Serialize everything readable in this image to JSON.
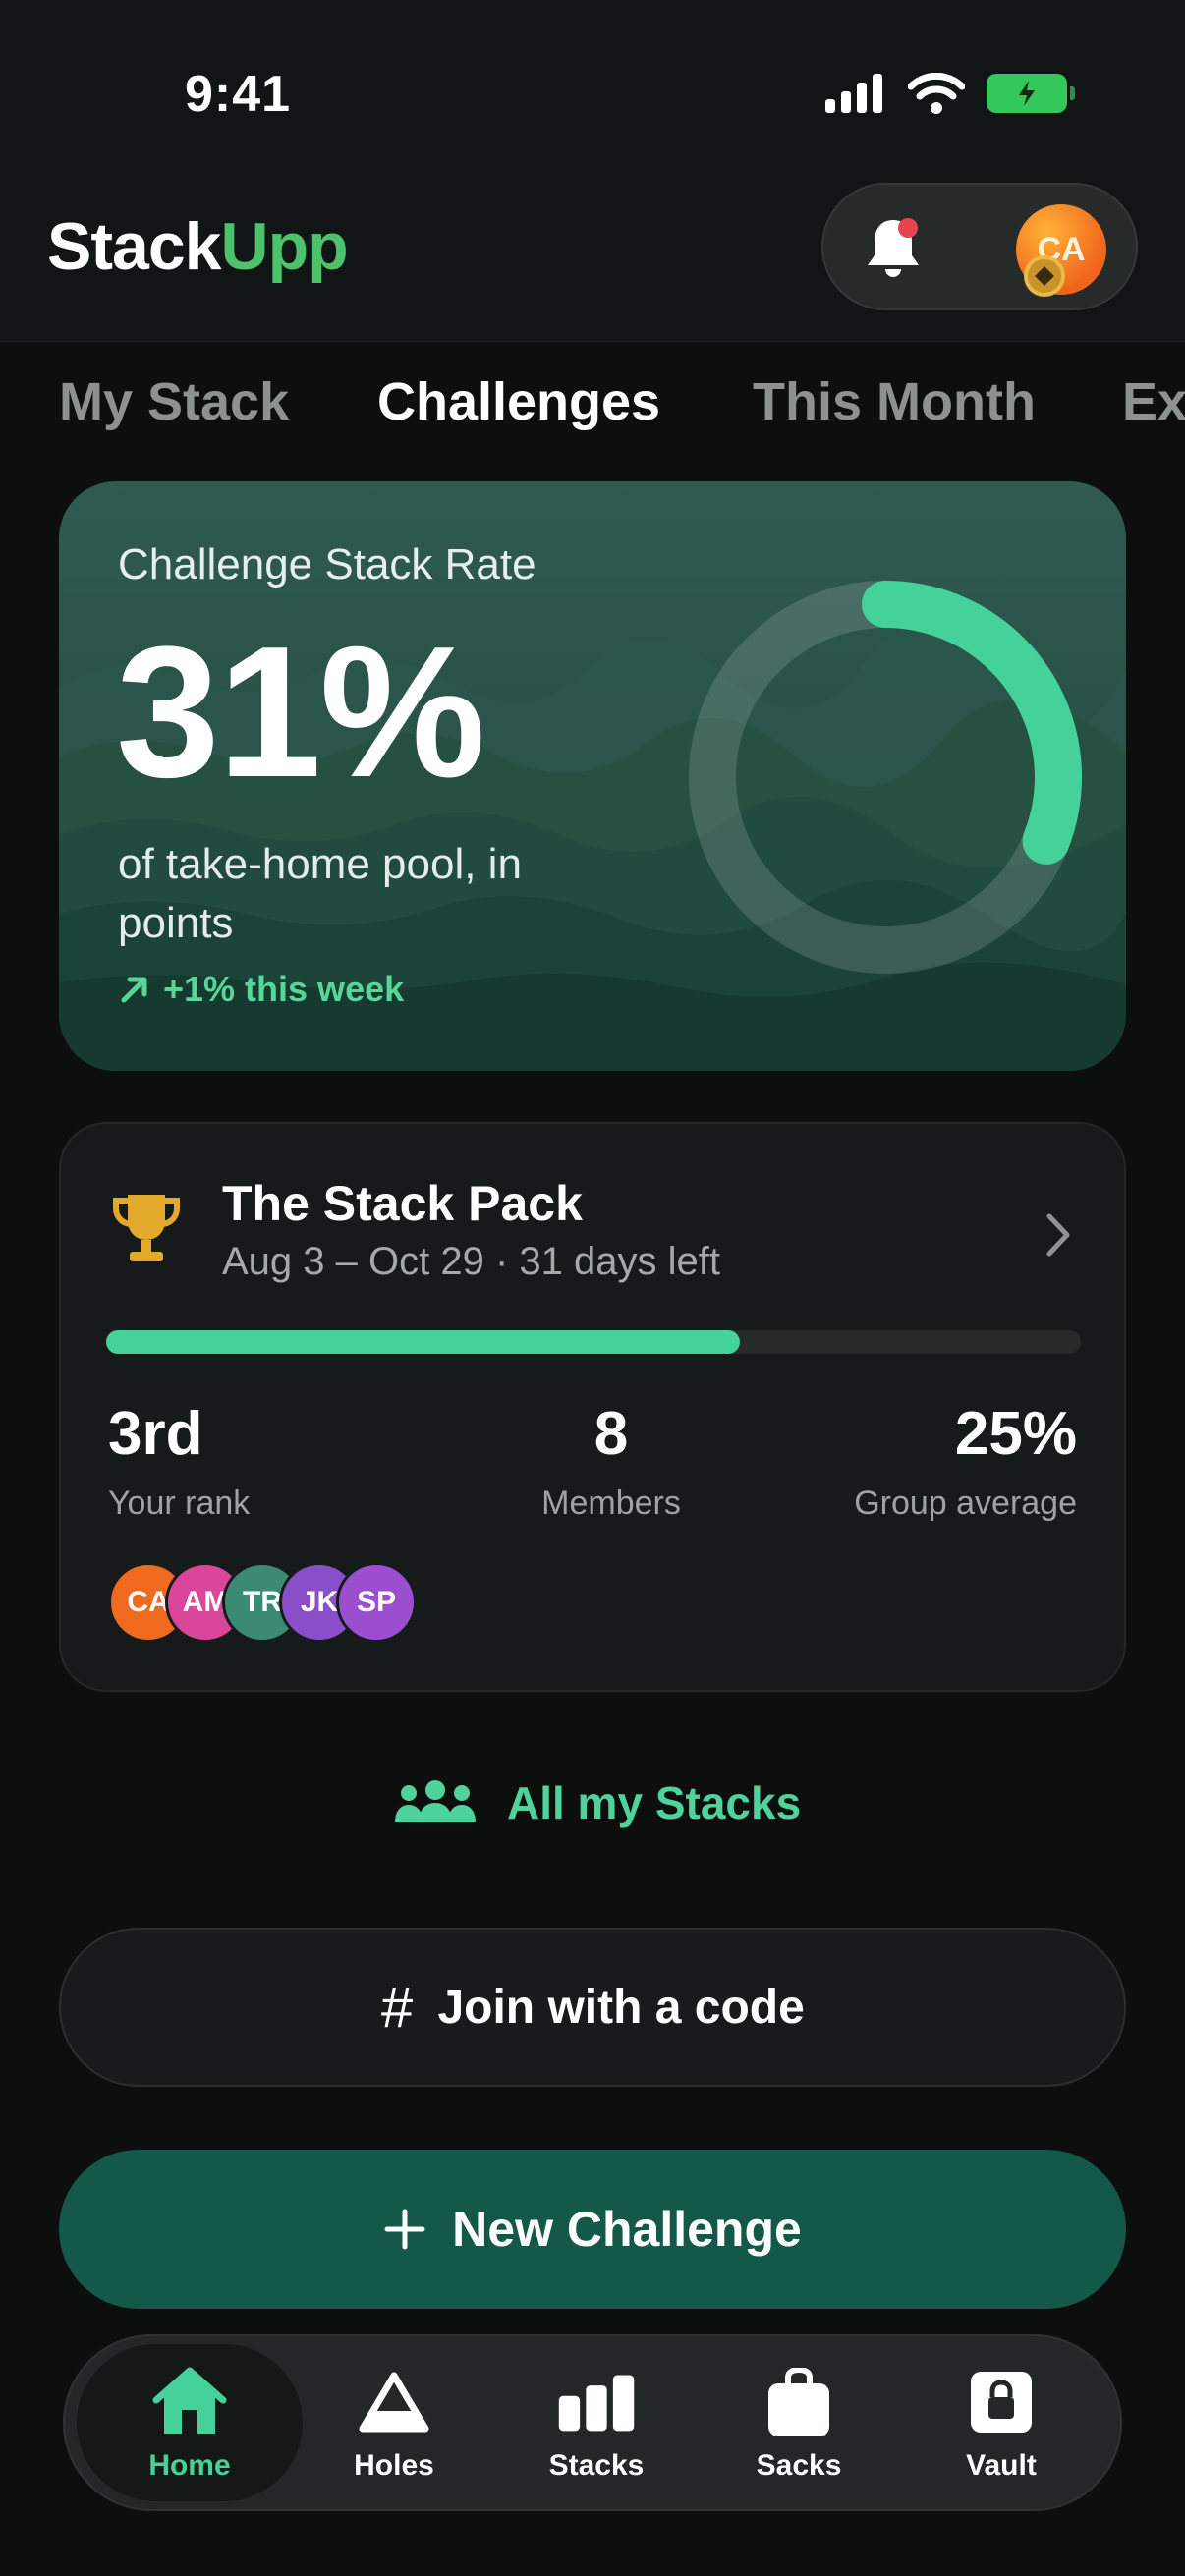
{
  "status_bar": {
    "time": "9:41"
  },
  "header": {
    "logo_part1": "Stack",
    "logo_part2": "Upp",
    "avatar_initials": "CA"
  },
  "tabs": [
    {
      "label": "My Stack",
      "active": false
    },
    {
      "label": "Challenges",
      "active": true
    },
    {
      "label": "This Month",
      "active": false
    },
    {
      "label": "Ex",
      "active": false
    }
  ],
  "hero": {
    "title": "Challenge Stack Rate",
    "value": "31%",
    "description": "of take-home pool, in points",
    "trend": "+1% this week",
    "ring_fraction": 0.31,
    "accent_color": "#45d29a"
  },
  "pack": {
    "title": "The Stack Pack",
    "subtitle": "Aug 3 – Oct 29 · 31 days left",
    "progress_fraction": 0.65,
    "stats": [
      {
        "value": "3rd",
        "label": "Your rank"
      },
      {
        "value": "8",
        "label": "Members"
      },
      {
        "value": "25%",
        "label": "Group average"
      }
    ],
    "members": [
      {
        "initials": "CA",
        "color": "#ef6a1f"
      },
      {
        "initials": "AM",
        "color": "#d9469a"
      },
      {
        "initials": "TR",
        "color": "#3a8a74"
      },
      {
        "initials": "JK",
        "color": "#8a4fc8"
      },
      {
        "initials": "SP",
        "color": "#9b4fcf"
      }
    ]
  },
  "links": {
    "all_stacks": "All my Stacks"
  },
  "buttons": {
    "join": "Join with a code",
    "new_challenge": "New Challenge"
  },
  "nav": [
    {
      "label": "Home",
      "icon": "home-icon",
      "active": true
    },
    {
      "label": "Holes",
      "icon": "flag-triangle-icon",
      "active": false
    },
    {
      "label": "Stacks",
      "icon": "bar-chart-icon",
      "active": false
    },
    {
      "label": "Sacks",
      "icon": "bag-icon",
      "active": false
    },
    {
      "label": "Vault",
      "icon": "lock-icon",
      "active": false
    }
  ]
}
